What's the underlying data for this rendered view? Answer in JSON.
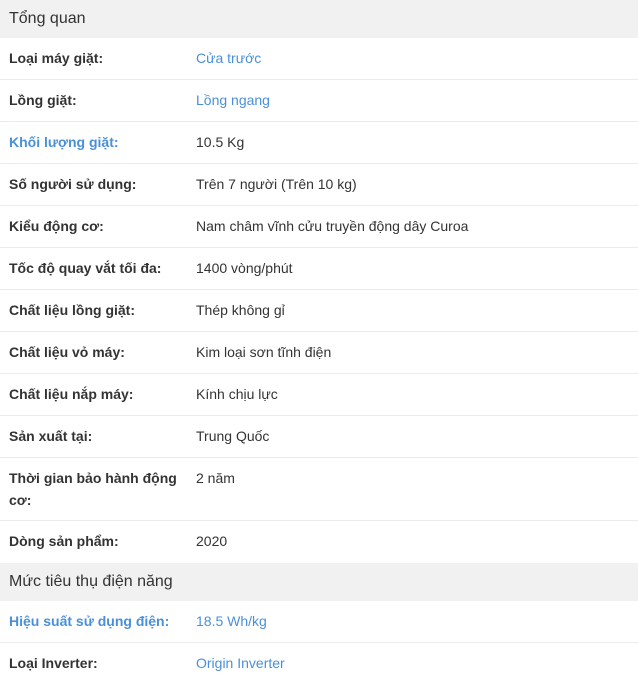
{
  "sections": [
    {
      "title": "Tổng quan",
      "rows": [
        {
          "label": "Loại máy giặt:",
          "value": "Cửa trước"
        },
        {
          "label": "Lồng giặt:",
          "value": "Lồng ngang"
        },
        {
          "label": "Khối lượng giặt:",
          "value": "10.5 Kg"
        },
        {
          "label": "Số người sử dụng:",
          "value": "Trên 7 người (Trên 10 kg)"
        },
        {
          "label": "Kiểu động cơ:",
          "value": "Nam châm vĩnh cửu truyền động dây Curoa"
        },
        {
          "label": "Tốc độ quay vắt tối đa:",
          "value": "1400 vòng/phút"
        },
        {
          "label": "Chất liệu lồng giặt:",
          "value": "Thép không gỉ"
        },
        {
          "label": "Chất liệu vỏ máy:",
          "value": "Kim loại sơn tĩnh điện"
        },
        {
          "label": "Chất liệu nắp máy:",
          "value": "Kính chịu lực"
        },
        {
          "label": "Sản xuất tại:",
          "value": "Trung Quốc"
        },
        {
          "label": "Thời gian bảo hành động cơ:",
          "value": "2 năm"
        },
        {
          "label": "Dòng sản phẩm:",
          "value": "2020"
        }
      ]
    },
    {
      "title": "Mức tiêu thụ điện năng",
      "rows": [
        {
          "label": "Hiệu suất sử dụng điện:",
          "value": "18.5 Wh/kg"
        },
        {
          "label": "Loại Inverter:",
          "value": "Origin Inverter"
        }
      ]
    }
  ],
  "colors": {
    "link": "#4a90d9",
    "header_bg": "#f1f1f1",
    "divider": "#ebebeb",
    "text": "#333333"
  }
}
